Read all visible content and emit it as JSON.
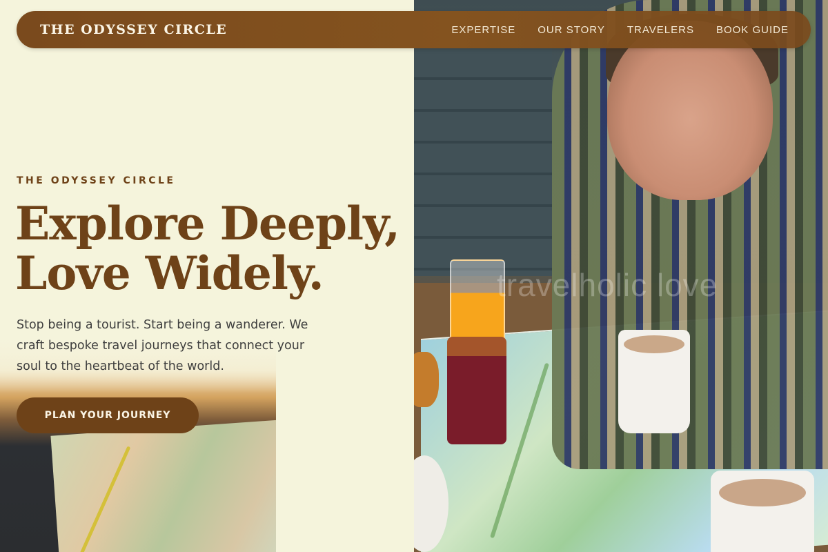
{
  "brand": {
    "name": "THE ODYSSEY CIRCLE"
  },
  "nav": {
    "items": [
      {
        "label": "EXPERTISE"
      },
      {
        "label": "OUR STORY"
      },
      {
        "label": "TRAVELERS"
      },
      {
        "label": "BOOK GUIDE"
      }
    ]
  },
  "hero": {
    "eyebrow": "THE ODYSSEY CIRCLE",
    "headline_line1": "Explore Deeply,",
    "headline_line2": "Love Widely.",
    "subtext": "Stop being a tourist. Start being a wanderer. We craft bespoke travel journeys that connect your soul to the heartbeat of the world.",
    "cta_label": "PLAN YOUR JOURNEY"
  },
  "photo": {
    "watermark": "travelholic love"
  },
  "colors": {
    "accent": "#6e4218",
    "nav_bg": "#7a4a1d",
    "page_bg": "#f5f4dc",
    "text": "#3e3e3e"
  }
}
